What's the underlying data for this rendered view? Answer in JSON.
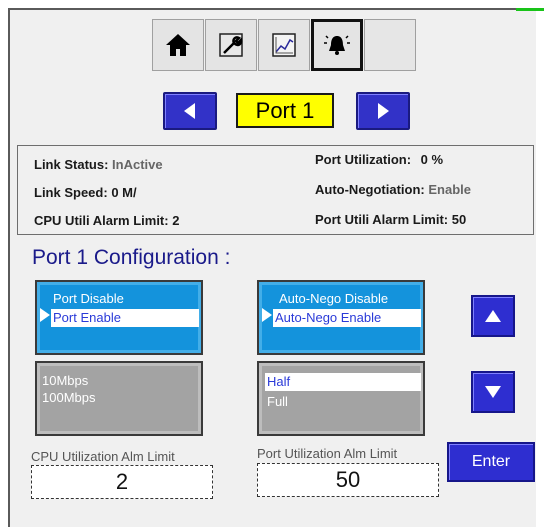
{
  "colors": {
    "accent_blue": "#3232c8",
    "port_field_bg": "#ffff00",
    "listbox_active": "#1493dc",
    "listbox_inactive": "#a3a3a3",
    "title_color": "#1a1a8a"
  },
  "nav": {
    "buttons": [
      {
        "icon": "home-icon",
        "selected": false
      },
      {
        "icon": "wrench-icon",
        "selected": false
      },
      {
        "icon": "trend-chart-icon",
        "selected": false
      },
      {
        "icon": "alarm-bell-icon",
        "selected": true
      },
      {
        "icon": "blank",
        "selected": false
      }
    ]
  },
  "port_selector": {
    "current_port": "Port 1",
    "prev_icon": "triangle-left-icon",
    "next_icon": "triangle-right-icon"
  },
  "status": {
    "link_status_label": "Link Status:",
    "link_status_value": "InActive",
    "link_speed_label": "Link Speed:",
    "link_speed_value": "0 M/",
    "cpu_alarm_label": "CPU Utili Alarm Limit:",
    "cpu_alarm_value": "2",
    "port_util_label": "Port Utilization:",
    "port_util_value": "0 %",
    "auto_neg_label": "Auto-Negotiation:",
    "auto_neg_value": "Enable",
    "port_alarm_label": "Port Utili Alarm Limit:",
    "port_alarm_value": "50"
  },
  "config": {
    "title": "Port 1 Configuration :",
    "port_enable_list": {
      "items": [
        "Port Disable",
        "Port Enable"
      ],
      "selected": "Port Enable"
    },
    "auto_nego_list": {
      "items": [
        "Auto-Nego Disable",
        "Auto-Nego Enable"
      ],
      "selected": "Auto-Nego Enable"
    },
    "speed_list": {
      "items": [
        "10Mbps",
        "100Mbps"
      ],
      "selected": null
    },
    "duplex_list": {
      "items": [
        "Half",
        "Full"
      ],
      "selected": "Half"
    },
    "scroll_up_icon": "triangle-up-icon",
    "scroll_down_icon": "triangle-down-icon",
    "cpu_limit_label": "CPU Utilization Alm Limit",
    "cpu_limit_value": "2",
    "port_limit_label": "Port Utilization Alm Limit",
    "port_limit_value": "50",
    "enter_label": "Enter"
  }
}
